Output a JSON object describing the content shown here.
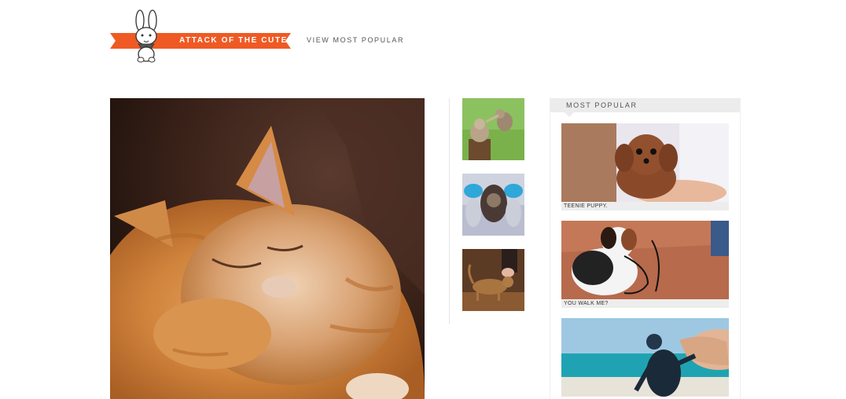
{
  "header": {
    "logo_text": "ATTACK OF THE CUTE",
    "nav_link": "VIEW MOST POPULAR"
  },
  "main": {
    "image_icon": "sleeping-orange-kitten"
  },
  "thumbnails": [
    {
      "icon": "kittens-fighting-thumb"
    },
    {
      "icon": "puppies-in-beanies-thumb"
    },
    {
      "icon": "cat-walking-thumb"
    }
  ],
  "sidebar": {
    "title": "MOST POPULAR",
    "items": [
      {
        "caption": "TEENIE PUPPY.",
        "icon": "brown-puppy-photo"
      },
      {
        "caption": "YOU WALK ME?",
        "icon": "beagle-puppy-photo"
      },
      {
        "caption": "",
        "icon": "baby-turtle-photo"
      }
    ]
  },
  "colors": {
    "accent": "#ef5a24",
    "sidebar_header": "#ececec",
    "caption_bg": "#ededed"
  }
}
